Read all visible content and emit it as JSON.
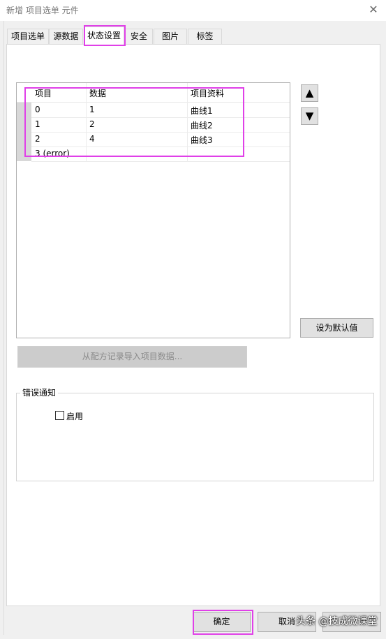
{
  "window": {
    "title": "新增 项目选单 元件",
    "close_glyph": "✕"
  },
  "tabs": [
    {
      "label": "项目选单",
      "active": false
    },
    {
      "label": "源数据",
      "active": false
    },
    {
      "label": "状态设置",
      "active": true
    },
    {
      "label": "安全",
      "active": false
    },
    {
      "label": "图片",
      "active": false
    },
    {
      "label": "标签",
      "active": false
    }
  ],
  "grid": {
    "columns": [
      "项目",
      "数据",
      "项目资料"
    ],
    "rows": [
      [
        "0",
        "1",
        "曲线1"
      ],
      [
        "1",
        "2",
        "曲线2"
      ],
      [
        "2",
        "4",
        "曲线3"
      ],
      [
        "3 (error)",
        "",
        ""
      ]
    ]
  },
  "buttons": {
    "move_up": "▲",
    "move_down": "▼",
    "set_default": "设为默认值",
    "import_recipe": "从配方记录导入项目数据...",
    "ok": "确定",
    "cancel": "取消"
  },
  "error_notice": {
    "legend": "错误通知",
    "enable_label": "启用",
    "enabled": false
  },
  "watermark": "头条 @技成微课堂",
  "colors": {
    "highlight": "#e040e8",
    "panel": "#ffffff",
    "background": "#f0f0f0"
  }
}
